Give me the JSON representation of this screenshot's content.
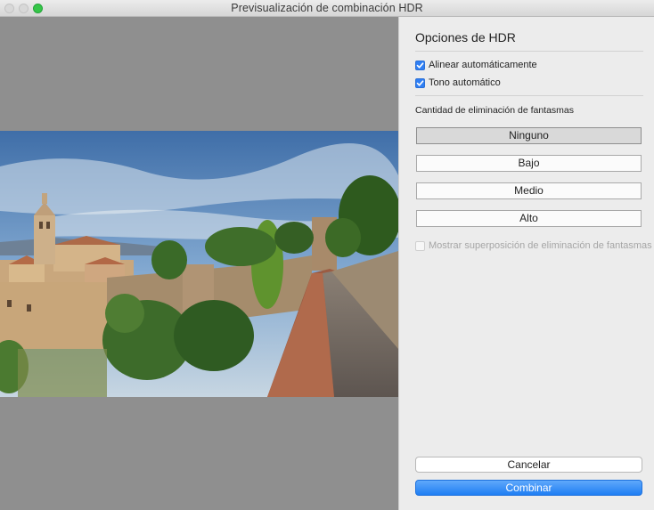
{
  "window": {
    "title": "Previsualización de combinación HDR"
  },
  "panel": {
    "heading": "Opciones de HDR",
    "options": [
      {
        "label": "Alinear automáticamente",
        "checked": true
      },
      {
        "label": "Tono automático",
        "checked": true
      }
    ],
    "deghost": {
      "label": "Cantidad de eliminación de fantasmas",
      "levels": [
        "Ninguno",
        "Bajo",
        "Medio",
        "Alto"
      ],
      "selected": "Ninguno"
    },
    "overlay_option": {
      "label": "Mostrar superposición de eliminación de fantasmas",
      "checked": false,
      "enabled": false
    },
    "cancel_label": "Cancelar",
    "combine_label": "Combinar"
  },
  "colors": {
    "accent": "#2f7ff4",
    "preview_bg": "#8f8f8f",
    "zoom_button": "#35c648"
  },
  "icons": {
    "check": "checkmark-icon"
  }
}
